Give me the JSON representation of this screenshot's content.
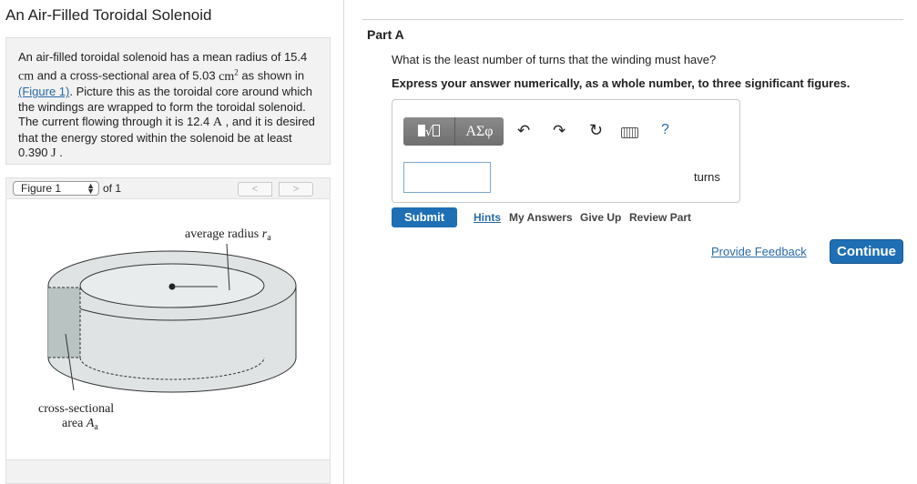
{
  "page": {
    "title": "An Air-Filled Toroidal Solenoid"
  },
  "problem": {
    "text_1": "An air-filled toroidal solenoid has a mean radius of 15.4",
    "unit_cm": "cm",
    "text_2": " and a cross-sectional area of 5.03 ",
    "unit_cm2": "cm",
    "unit_cm2_exp": "2",
    "text_3": " as shown in",
    "figure_link": "(Figure 1)",
    "text_4": ". Picture this as the toroidal core around which the windings are wrapped to form the toroidal solenoid. The current flowing through it is 12.4 ",
    "unit_A": "A",
    "text_5": " , and it is desired that the energy stored within the solenoid be at least 0.390 ",
    "unit_J": "J",
    "text_6": " ."
  },
  "figure_nav": {
    "selected": "Figure 1",
    "of_label": "of 1",
    "prev_label": "<",
    "next_label": ">"
  },
  "figure": {
    "label_radius": "average radius ",
    "label_radius_symbol": "r",
    "label_radius_sub": "a",
    "label_area_line1": "cross-sectional",
    "label_area_line2": "area ",
    "label_area_symbol": "A",
    "label_area_sub": "a",
    "colors": {
      "torus_fill": "#dfe3e3",
      "section_fill": "#b9c3c1",
      "stroke": "#333333"
    }
  },
  "part": {
    "title": "Part A",
    "question": "What is the least number of turns that the winding must have?",
    "instruction": "Express your answer numerically, as a whole number, to three significant figures."
  },
  "toolbar": {
    "templates_icon": "templates-icon",
    "symbols_label": "ΑΣφ",
    "undo_icon": "undo-icon",
    "redo_icon": "redo-icon",
    "reset_icon": "reset-icon",
    "keyboard_icon": "keyboard-icon",
    "help_label": "?"
  },
  "answer": {
    "value": "",
    "unit": "turns"
  },
  "actions": {
    "submit": "Submit",
    "hints": "Hints",
    "my_answers": "My Answers",
    "give_up": "Give Up",
    "review_part": "Review Part"
  },
  "footer": {
    "feedback": "Provide Feedback",
    "continue": "Continue"
  },
  "colors": {
    "accent": "#1f6fb5",
    "link": "#2a6aa8"
  }
}
